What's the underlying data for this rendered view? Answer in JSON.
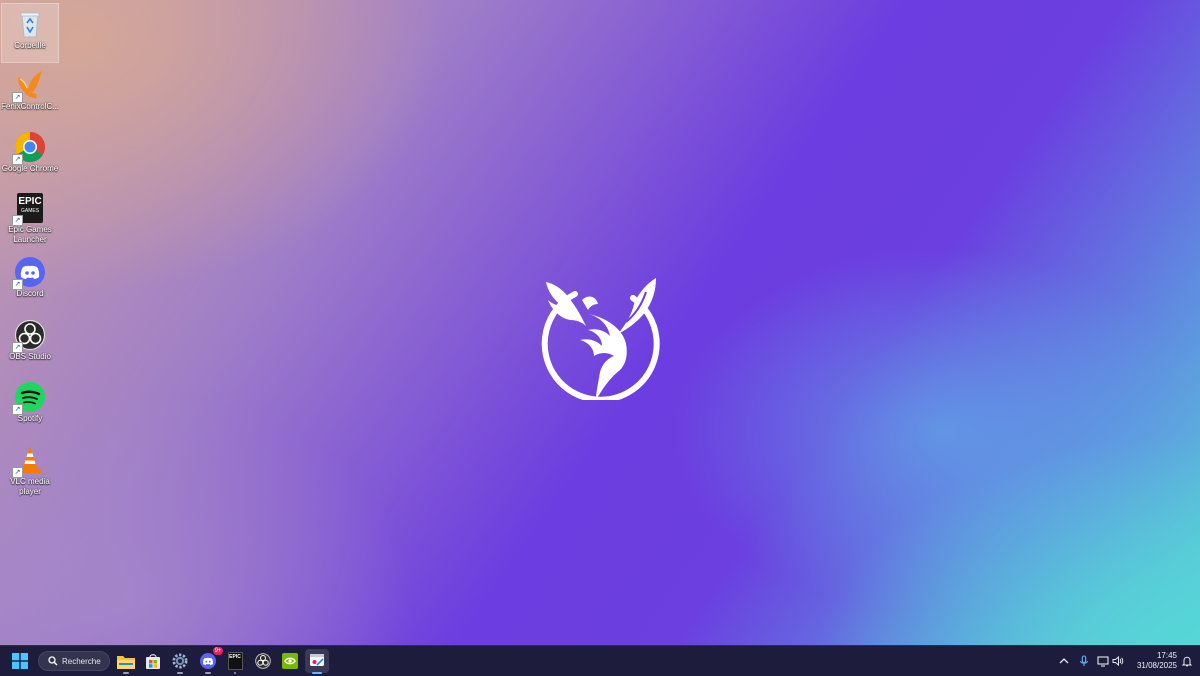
{
  "desktop": {
    "icons": [
      {
        "name": "recycle-bin",
        "label": "Corbeille"
      },
      {
        "name": "fenixcontrolcenter",
        "label": "FenixControlC..."
      },
      {
        "name": "google-chrome",
        "label": "Google Chrome"
      },
      {
        "name": "epic-games-launcher",
        "label": "Epic Games Launcher"
      },
      {
        "name": "discord",
        "label": "Discord"
      },
      {
        "name": "obs-studio",
        "label": "OBS Studio"
      },
      {
        "name": "spotify",
        "label": "Spotify"
      },
      {
        "name": "vlc-media-player",
        "label": "VLC media player"
      }
    ],
    "epic_icon_text": "EPIC",
    "epic_icon_subtext": "GAMES",
    "wallpaper_colors": {
      "purple": "#6c3de0",
      "peach": "#c8a0a8",
      "cyan": "#58d6d8"
    }
  },
  "taskbar": {
    "search_label": "Recherche",
    "discord_badge": "9+",
    "epic_text": "EPIC",
    "pinned": [
      "start-button",
      "search",
      "file-explorer",
      "microsoft-store",
      "settings",
      "discord",
      "epic-games",
      "obs-studio",
      "nvidia",
      "snipping-tool"
    ],
    "clock_time": "17:45",
    "clock_date": "31/08/2025",
    "accent_color": "#6fb6ff"
  }
}
